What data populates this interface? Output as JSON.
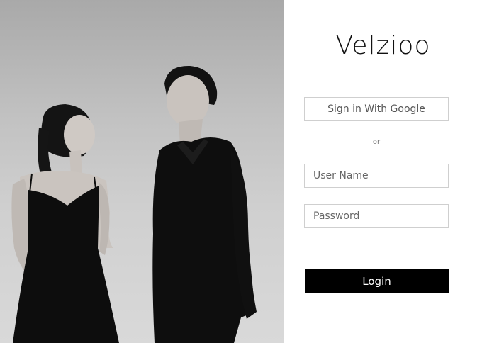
{
  "brand": {
    "name": "Velzioo"
  },
  "login": {
    "google_button_label": "Sign in With Google",
    "divider_text": "or",
    "username_placeholder": "User Name",
    "password_placeholder": "Password",
    "login_button_label": "Login"
  },
  "colors": {
    "button_background": "#000000",
    "border": "#cfcfcf",
    "text": "#111111"
  }
}
